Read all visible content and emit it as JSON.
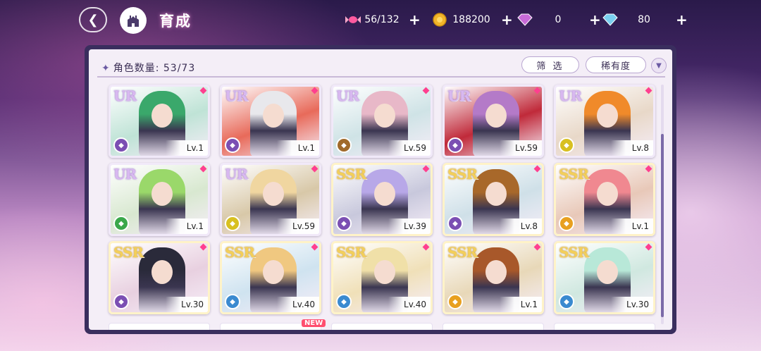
{
  "header": {
    "title": "育成",
    "back_icon": "back-arrow-icon",
    "home_icon": "castle-home-icon"
  },
  "currencies": [
    {
      "icon": "candy-icon",
      "value": "56/132"
    },
    {
      "icon": "gold-coin-icon",
      "value": "188200"
    },
    {
      "icon": "purple-gem-icon",
      "value": "0"
    },
    {
      "icon": "blue-diamond-icon",
      "value": "80"
    }
  ],
  "panel": {
    "count_label": "角色数量: 53/73",
    "filter_label": "筛 选",
    "sort_label": "稀有度"
  },
  "cards": [
    {
      "rarity": "UR",
      "level": "Lv.1",
      "element_color": "#7b4fb3",
      "bg": "#bfe3d6",
      "hair": "#3aa86b"
    },
    {
      "rarity": "UR",
      "level": "Lv.1",
      "element_color": "#7b4fb3",
      "bg": "#e86a5a",
      "hair": "#e8e8ec"
    },
    {
      "rarity": "UR",
      "level": "Lv.59",
      "element_color": "#a06a2a",
      "bg": "#cfe3e6",
      "hair": "#e8b8c8"
    },
    {
      "rarity": "UR",
      "level": "Lv.59",
      "element_color": "#7b4fb3",
      "bg": "#c02a3a",
      "hair": "#b47ac8"
    },
    {
      "rarity": "UR",
      "level": "Lv.8",
      "element_color": "#d8c020",
      "bg": "#e8d8c8",
      "hair": "#f08a2a"
    },
    {
      "rarity": "UR",
      "level": "Lv.1",
      "element_color": "#3aa84a",
      "bg": "#d8e8d0",
      "hair": "#9ad86a"
    },
    {
      "rarity": "UR",
      "level": "Lv.59",
      "element_color": "#d8c020",
      "bg": "#d8c8a8",
      "hair": "#f0d6a0"
    },
    {
      "rarity": "SSR",
      "level": "Lv.39",
      "element_color": "#7b4fb3",
      "bg": "#c8c8dc",
      "hair": "#b8a8e8"
    },
    {
      "rarity": "SSR",
      "level": "Lv.8",
      "element_color": "#7b4fb3",
      "bg": "#cfe0e8",
      "hair": "#a8682a"
    },
    {
      "rarity": "SSR",
      "level": "Lv.1",
      "element_color": "#e8a020",
      "bg": "#e8c8b8",
      "hair": "#f08890"
    },
    {
      "rarity": "SSR",
      "level": "Lv.30",
      "element_color": "#7b4fb3",
      "bg": "#e8d0e0",
      "hair": "#2a2a3a"
    },
    {
      "rarity": "SSR",
      "level": "Lv.40",
      "element_color": "#3a8ad0",
      "bg": "#cfe3f0",
      "hair": "#f0c880"
    },
    {
      "rarity": "SSR",
      "level": "Lv.40",
      "element_color": "#3a8ad0",
      "bg": "#f0e0b8",
      "hair": "#f0e0a8"
    },
    {
      "rarity": "SSR",
      "level": "Lv.1",
      "element_color": "#e8a020",
      "bg": "#e8d8b8",
      "hair": "#a8582a"
    },
    {
      "rarity": "SSR",
      "level": "Lv.30",
      "element_color": "#3a8ad0",
      "bg": "#d0e8e0",
      "hair": "#b8e8d8"
    }
  ],
  "new_badge": "NEW"
}
